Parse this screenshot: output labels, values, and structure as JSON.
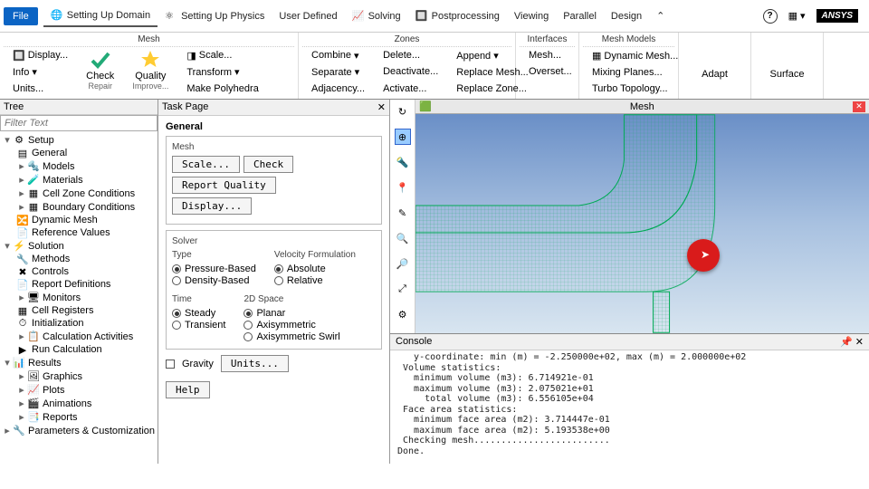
{
  "menubar": {
    "file": "File",
    "tabs": [
      "Setting Up Domain",
      "Setting Up Physics",
      "User Defined",
      "Solving",
      "Postprocessing",
      "Viewing",
      "Parallel",
      "Design"
    ],
    "logo": "ANSYS"
  },
  "ribbon": {
    "mesh": {
      "title": "Mesh",
      "display": "Display...",
      "info": "Info",
      "units": "Units...",
      "check": "Check",
      "repair": "Repair",
      "quality": "Quality",
      "improve": "Improve...",
      "scale": "Scale...",
      "transform": "Transform",
      "polyhedra": "Make Polyhedra",
      "combine": "Combine",
      "separate": "Separate",
      "adjacency": "Adjacency..."
    },
    "zones": {
      "title": "Zones",
      "delete": "Delete...",
      "deactivate": "Deactivate...",
      "activate": "Activate...",
      "append": "Append",
      "replace_mesh": "Replace Mesh...",
      "replace_zone": "Replace Zone..."
    },
    "interfaces": {
      "title": "Interfaces",
      "mesh": "Mesh...",
      "overset": "Overset..."
    },
    "mesh_models": {
      "title": "Mesh Models",
      "dynamic": "Dynamic Mesh...",
      "mixing": "Mixing Planes...",
      "turbo": "Turbo Topology..."
    },
    "adapt": "Adapt",
    "surface": "Surface"
  },
  "tree": {
    "title": "Tree",
    "filter": "Filter Text",
    "setup": "Setup",
    "general": "General",
    "models": "Models",
    "materials": "Materials",
    "czc": "Cell Zone Conditions",
    "bc": "Boundary Conditions",
    "dm": "Dynamic Mesh",
    "rv": "Reference Values",
    "solution": "Solution",
    "methods": "Methods",
    "controls": "Controls",
    "rd": "Report Definitions",
    "monitors": "Monitors",
    "cr": "Cell Registers",
    "init": "Initialization",
    "ca": "Calculation Activities",
    "rc": "Run Calculation",
    "results": "Results",
    "graphics": "Graphics",
    "plots": "Plots",
    "animations": "Animations",
    "reports": "Reports",
    "pc": "Parameters & Customization"
  },
  "task": {
    "title": "Task Page",
    "heading": "General",
    "mesh_grp": "Mesh",
    "scale": "Scale...",
    "check": "Check",
    "report_q": "Report Quality",
    "display": "Display...",
    "solver_grp": "Solver",
    "type": "Type",
    "pb": "Pressure-Based",
    "db": "Density-Based",
    "vf": "Velocity Formulation",
    "abs": "Absolute",
    "rel": "Relative",
    "time": "Time",
    "steady": "Steady",
    "transient": "Transient",
    "space": "2D Space",
    "planar": "Planar",
    "axi": "Axisymmetric",
    "axis": "Axisymmetric Swirl",
    "gravity": "Gravity",
    "units": "Units...",
    "help": "Help"
  },
  "viewer": {
    "mesh_tab": "Mesh"
  },
  "console": {
    "title": "Console",
    "text": "   y-coordinate: min (m) = -2.250000e+02, max (m) = 2.000000e+02\n Volume statistics:\n   minimum volume (m3): 6.714921e-01\n   maximum volume (m3): 2.075021e+01\n     total volume (m3): 6.556105e+04\n Face area statistics:\n   minimum face area (m2): 3.714447e-01\n   maximum face area (m2): 5.193538e+00\n Checking mesh.........................\nDone."
  }
}
